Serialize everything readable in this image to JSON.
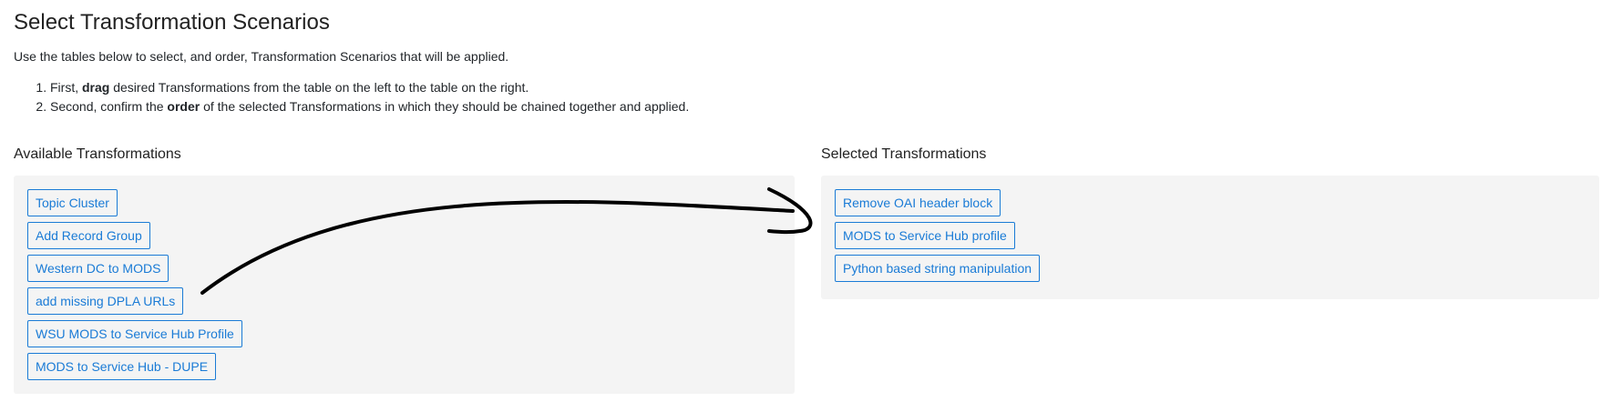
{
  "page": {
    "title": "Select Transformation Scenarios",
    "intro": "Use the tables below to select, and order, Transformation Scenarios that will be applied.",
    "steps": [
      {
        "prefix": "First, ",
        "bold": "drag",
        "suffix": " desired Transformations from the table on the left to the table on the right."
      },
      {
        "prefix": "Second, confirm the ",
        "bold": "order",
        "suffix": " of the selected Transformations in which they should be chained together and applied."
      }
    ]
  },
  "available": {
    "heading": "Available Transformations",
    "items": [
      "Topic Cluster",
      "Add Record Group",
      "Western DC to MODS",
      "add missing DPLA URLs",
      "WSU MODS to Service Hub Profile",
      "MODS to Service Hub - DUPE"
    ]
  },
  "selected": {
    "heading": "Selected Transformations",
    "items": [
      "Remove OAI header block",
      "MODS to Service Hub profile",
      "Python based string manipulation"
    ]
  },
  "colors": {
    "accent": "#1a7bd6",
    "well": "#f4f4f4",
    "annotation_stroke": "#000000"
  }
}
